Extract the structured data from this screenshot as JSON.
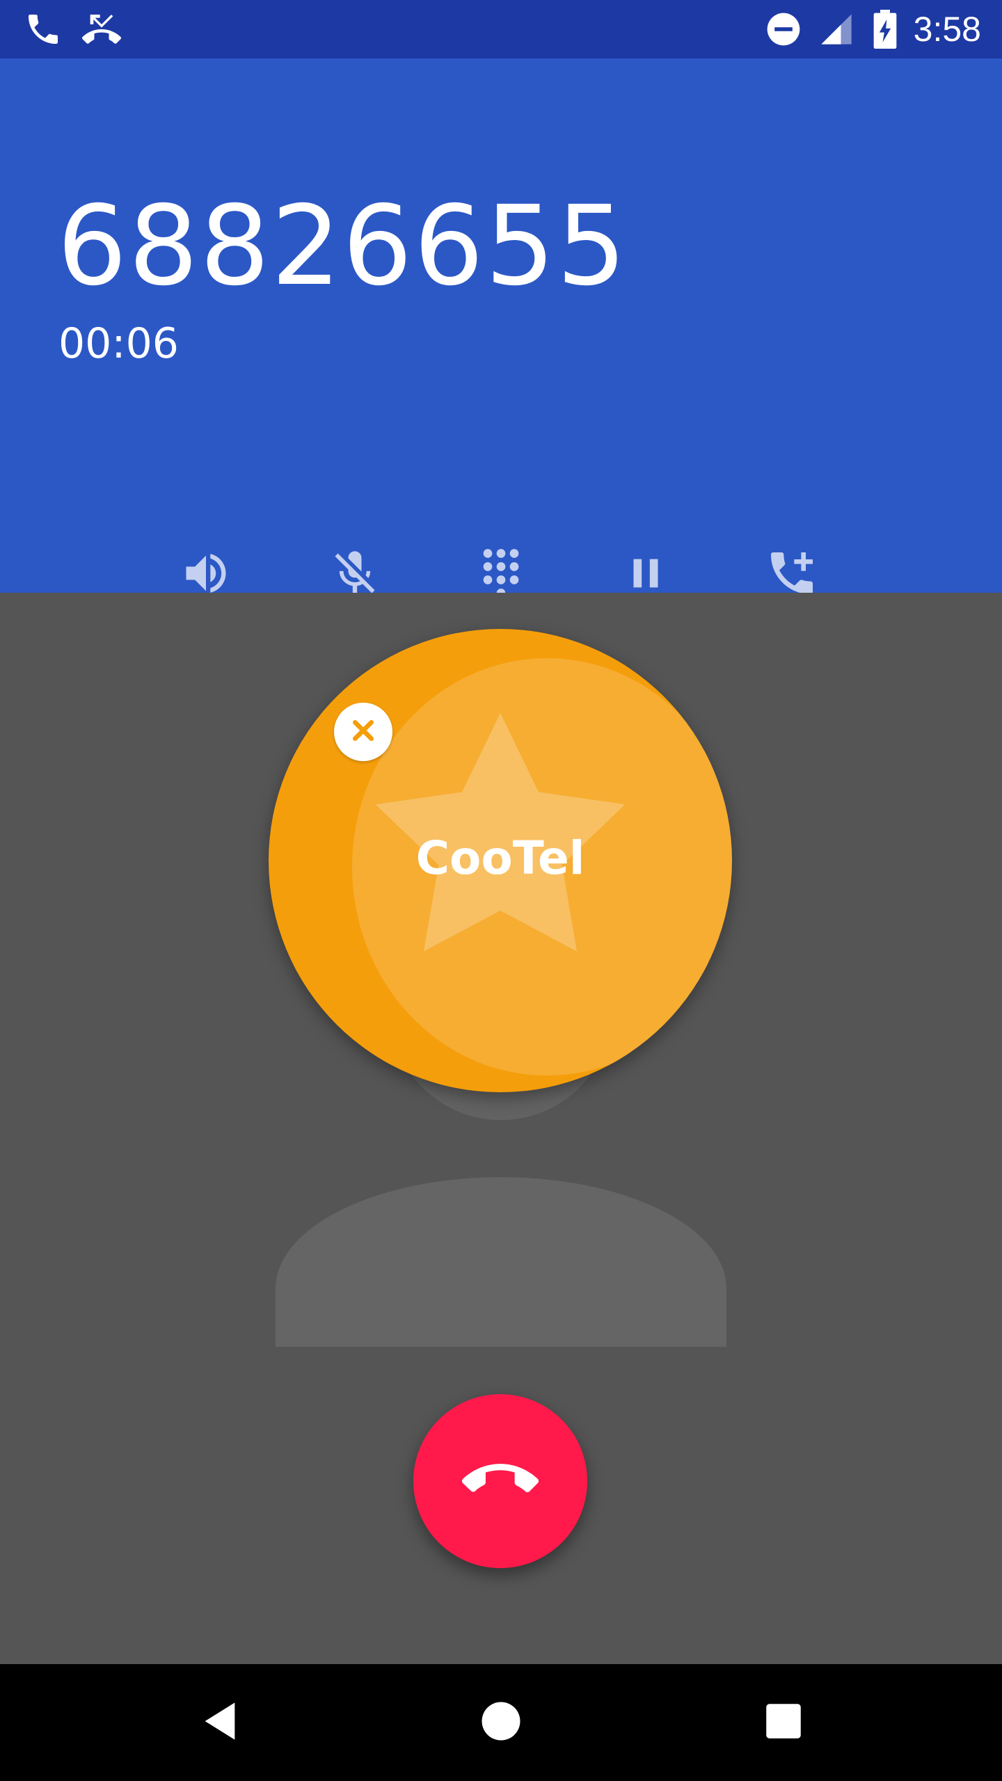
{
  "status_bar": {
    "time": "3:58",
    "left_icons": [
      "phone-icon",
      "missed-call-icon"
    ],
    "right_icons": [
      "do-not-disturb-icon",
      "cell-signal-icon",
      "battery-charging-icon"
    ],
    "background": "#1d39a4"
  },
  "call": {
    "number": "68826655",
    "timer": "00:06",
    "header_color": "#2c58c6"
  },
  "controls": [
    {
      "name": "speaker",
      "icon": "speaker-icon"
    },
    {
      "name": "mute",
      "icon": "mic-off-icon"
    },
    {
      "name": "dialpad",
      "icon": "dialpad-icon"
    },
    {
      "name": "hold",
      "icon": "pause-icon"
    },
    {
      "name": "add-call",
      "icon": "add-call-icon"
    }
  ],
  "bubble": {
    "label": "CooTel",
    "color": "#f59e0b",
    "icon": "star-icon",
    "close_icon": "close-icon"
  },
  "end_call": {
    "icon": "call-end-icon",
    "color": "#ff1a4b"
  },
  "nav_bar": {
    "buttons": [
      "back-icon",
      "home-icon",
      "recents-icon"
    ]
  }
}
